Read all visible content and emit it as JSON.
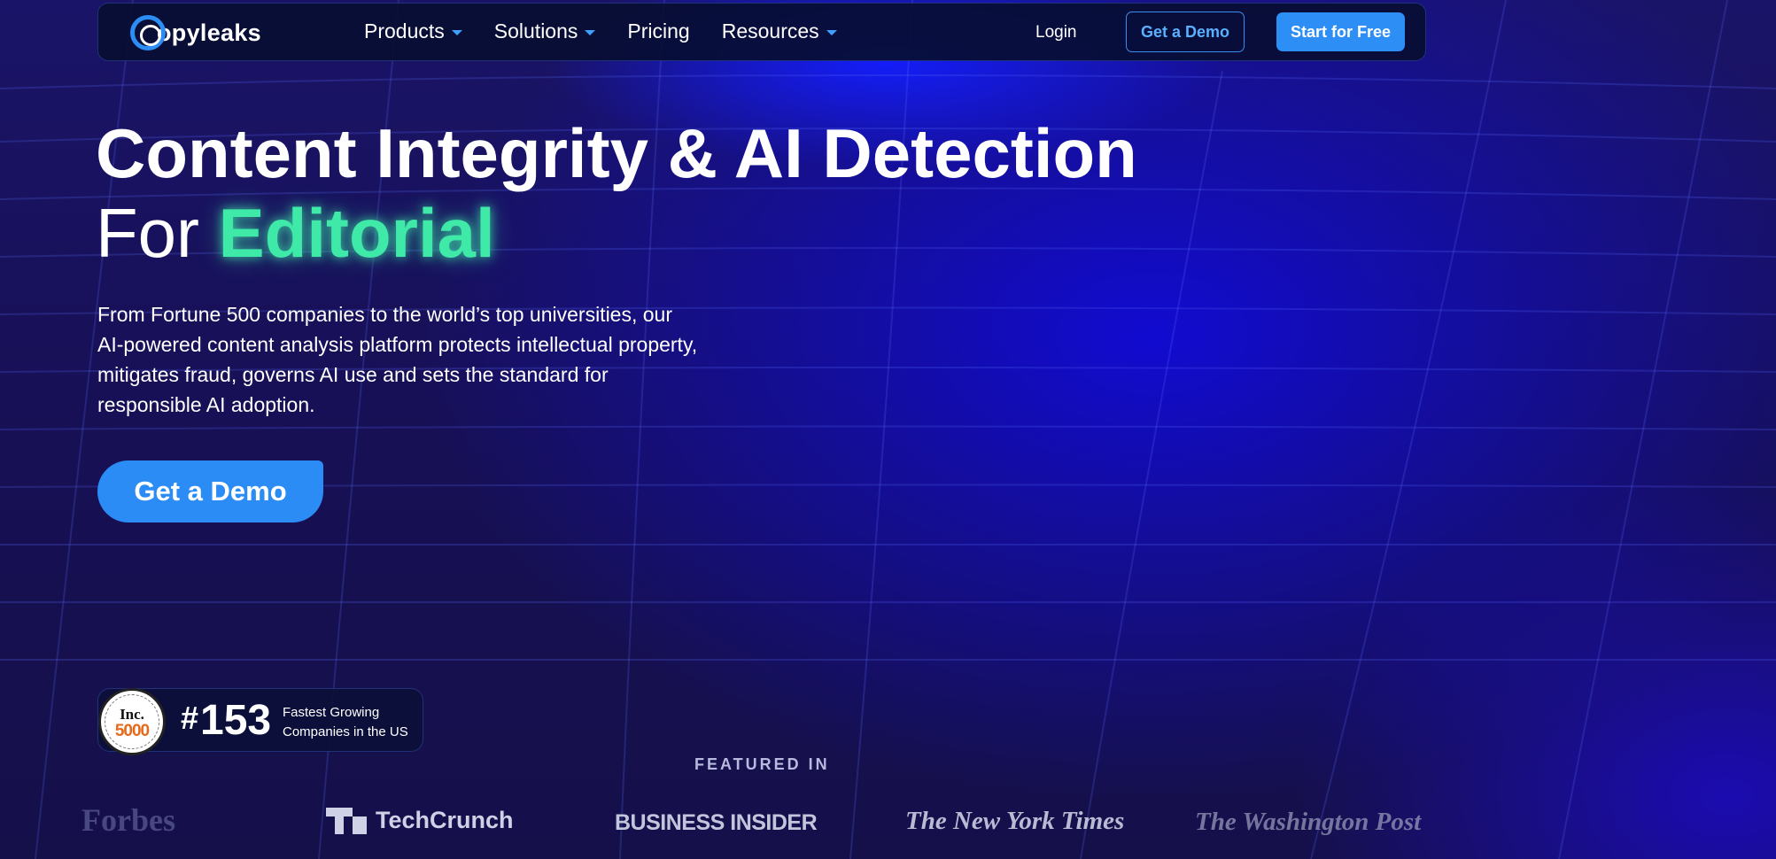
{
  "nav": {
    "logo_text": "opyleaks",
    "logo_initial": "C",
    "menu": [
      {
        "label": "Products",
        "has_dropdown": true
      },
      {
        "label": "Solutions",
        "has_dropdown": true
      },
      {
        "label": "Pricing",
        "has_dropdown": false
      },
      {
        "label": "Resources",
        "has_dropdown": true
      }
    ],
    "login": "Login",
    "demo_button": "Get a Demo",
    "start_button": "Start for Free"
  },
  "hero": {
    "title_line1": "Content Integrity & AI Detection",
    "title_prefix": "For ",
    "title_highlight": "Editorial",
    "description": "From Fortune 500 companies to the world’s top universities, our AI-powered content analysis platform protects intellectual property, mitigates fraud, governs AI use and sets the standard for responsible AI adoption.",
    "cta": "Get a Demo"
  },
  "badge": {
    "seal_top": "Inc.",
    "seal_number": "5000",
    "rank_hash": "#",
    "rank_number": "153",
    "line1": "Fastest Growing",
    "line2": "Companies in the US"
  },
  "featured": {
    "heading": "FEATURED IN",
    "outlets": [
      "Forbes",
      "TechCrunch",
      "BUSINESS INSIDER",
      "The New York Times",
      "The Washington Post"
    ]
  },
  "colors": {
    "accent_blue": "#2d8ef5",
    "highlight_green": "#3fe9a8",
    "background": "#15104a"
  }
}
